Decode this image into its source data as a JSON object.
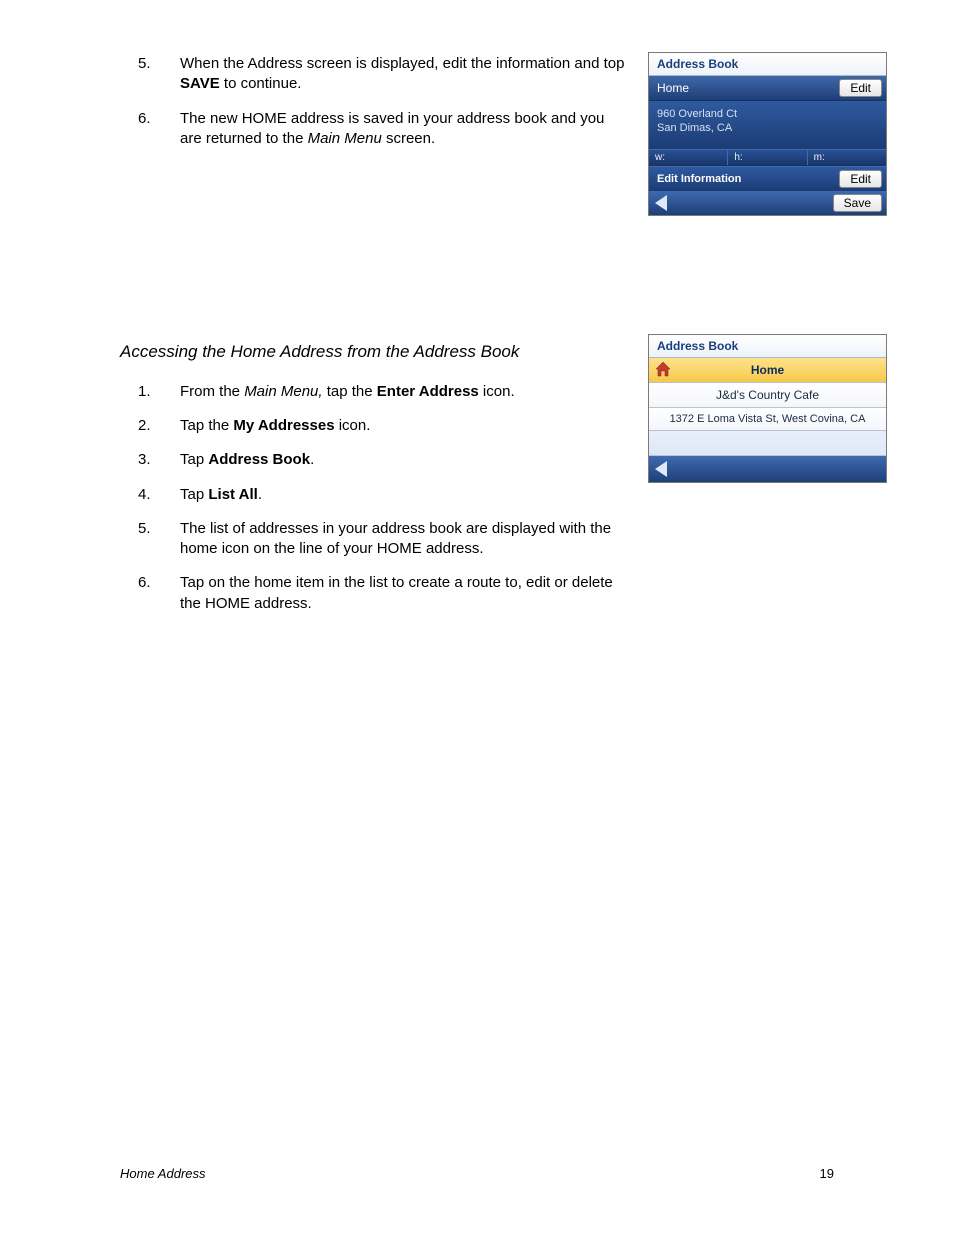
{
  "steps_a": [
    {
      "num": "5.",
      "parts": [
        {
          "t": "When the Address screen is displayed, edit the information and top "
        },
        {
          "t": "SAVE",
          "b": true
        },
        {
          "t": " to continue."
        }
      ]
    },
    {
      "num": "6.",
      "parts": [
        {
          "t": "The new HOME address is saved in your address book and you are returned to the "
        },
        {
          "t": "Main Menu",
          "i": true
        },
        {
          "t": " screen."
        }
      ]
    }
  ],
  "section_heading": "Accessing the Home Address from the Address Book",
  "steps_b": [
    {
      "num": "1.",
      "parts": [
        {
          "t": "From the "
        },
        {
          "t": "Main Menu,",
          "i": true
        },
        {
          "t": " tap the "
        },
        {
          "t": "Enter Address",
          "b": true
        },
        {
          "t": " icon."
        }
      ]
    },
    {
      "num": "2.",
      "parts": [
        {
          "t": "Tap the "
        },
        {
          "t": "My Addresses",
          "b": true
        },
        {
          "t": " icon."
        }
      ]
    },
    {
      "num": "3.",
      "parts": [
        {
          "t": "Tap "
        },
        {
          "t": "Address Book",
          "b": true
        },
        {
          "t": "."
        }
      ]
    },
    {
      "num": "4.",
      "parts": [
        {
          "t": "Tap "
        },
        {
          "t": "List All",
          "b": true
        },
        {
          "t": "."
        }
      ]
    },
    {
      "num": "5.",
      "parts": [
        {
          "t": "The list of addresses in your address book are displayed with the home icon on the line of your HOME address."
        }
      ]
    },
    {
      "num": "6.",
      "parts": [
        {
          "t": "Tap on the home item in the list to create a route to, edit or delete the HOME address."
        }
      ]
    }
  ],
  "shot1": {
    "title": "Address Book",
    "home_label": "Home",
    "edit_btn": "Edit",
    "address_line1": "960 Overland Ct",
    "address_line2": "San Dimas, CA",
    "tab_w": "w:",
    "tab_h": "h:",
    "tab_m": "m:",
    "edit_info_label": "Edit Information",
    "edit_btn2": "Edit",
    "save_btn": "Save"
  },
  "shot2": {
    "title": "Address Book",
    "row_home": "Home",
    "row_cafe": "J&d's Country Cafe",
    "row_addr": "1372 E Loma Vista St, West Covina, CA"
  },
  "footer": {
    "title": "Home Address",
    "page": "19"
  }
}
